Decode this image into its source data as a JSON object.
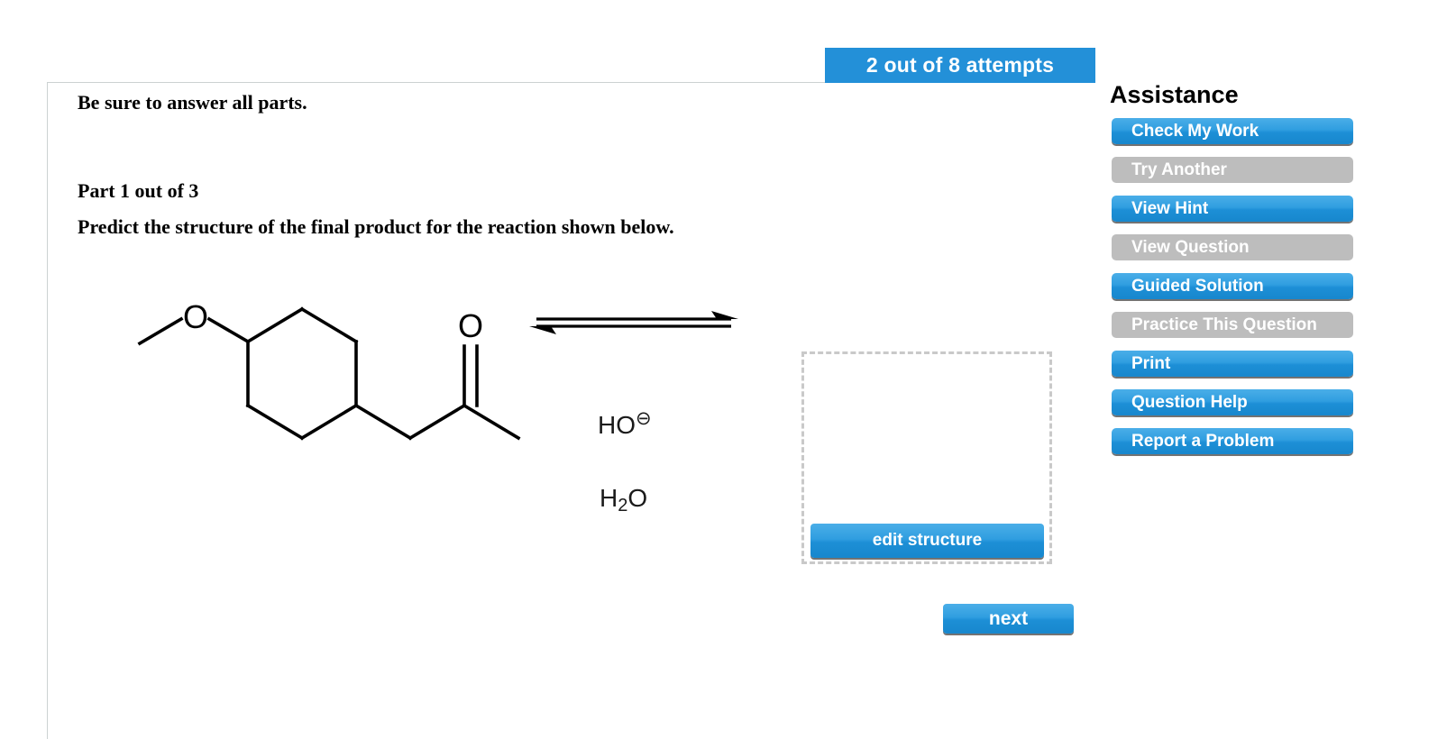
{
  "banner": {
    "attempts_text": "2 out of 8 attempts",
    "color": "#2390d8"
  },
  "question": {
    "answer_all_parts": "Be sure to answer all parts.",
    "part_label": "Part 1 out of 3",
    "prompt": "Predict the structure of the final product for the reaction shown below."
  },
  "reaction": {
    "reactant_name": "1-(4-methoxycyclohexyl)propan-2-one",
    "reagent_above_arrow": "HO",
    "reagent_above_charge": "⊖",
    "reagent_below_arrow_1": "H",
    "reagent_below_sub": "2",
    "reagent_below_arrow_2": "O",
    "arrow_type": "equilibrium-double-harpoon",
    "product_placeholder": ""
  },
  "buttons": {
    "edit_structure": "edit structure",
    "next": "next"
  },
  "assistance": {
    "title": "Assistance",
    "items": [
      {
        "label": "Check My Work",
        "state": "enabled"
      },
      {
        "label": "Try Another",
        "state": "disabled"
      },
      {
        "label": "View Hint",
        "state": "enabled"
      },
      {
        "label": "View Question",
        "state": "disabled"
      },
      {
        "label": "Guided Solution",
        "state": "enabled"
      },
      {
        "label": "Practice This Question",
        "state": "disabled"
      },
      {
        "label": "Print",
        "state": "enabled"
      },
      {
        "label": "Question Help",
        "state": "enabled"
      },
      {
        "label": "Report a Problem",
        "state": "enabled"
      }
    ],
    "enabled_color": "#2390d8",
    "disabled_color": "#bdbdbd"
  }
}
